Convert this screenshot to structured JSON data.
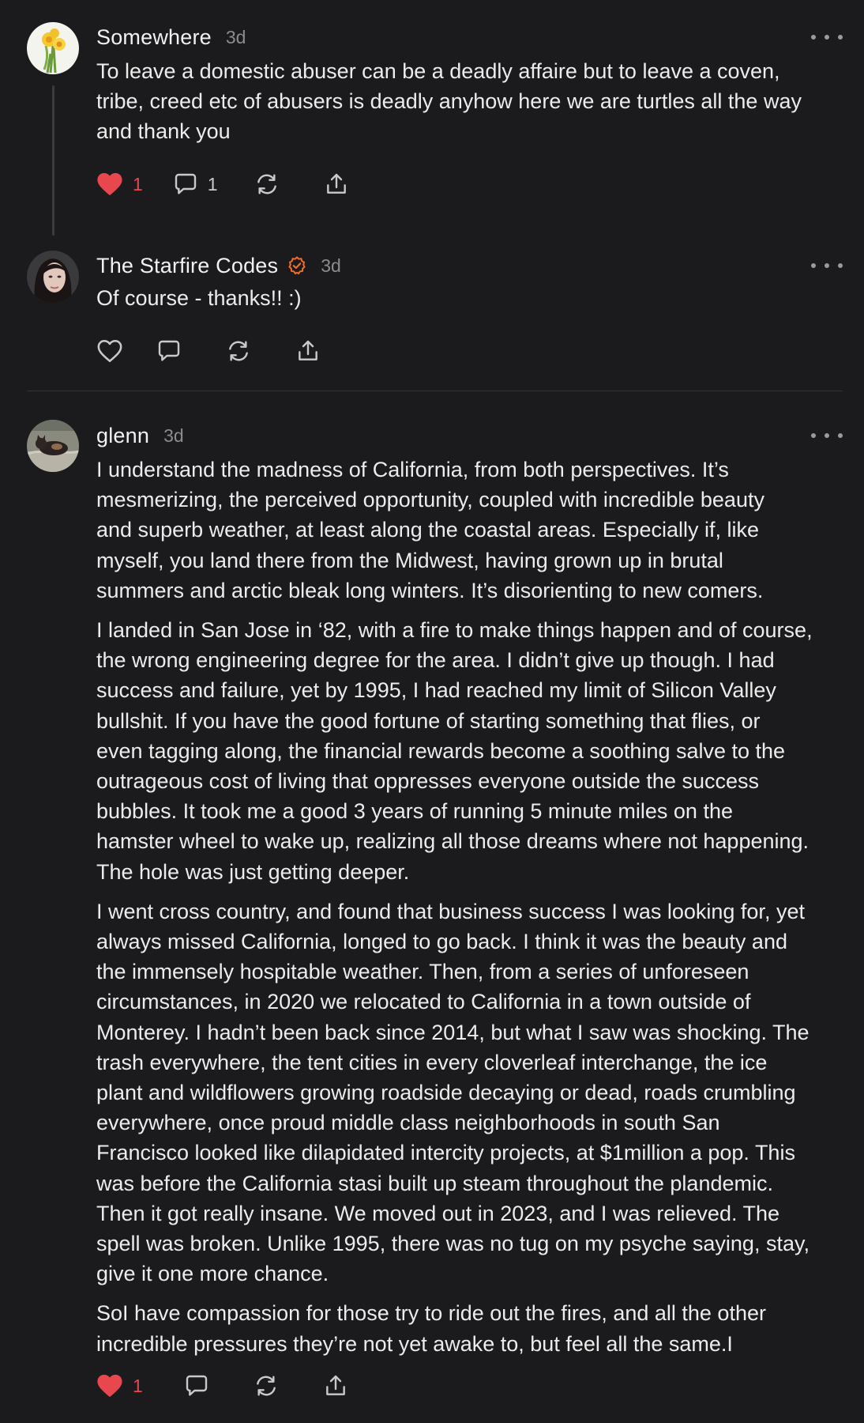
{
  "comments": [
    {
      "author": "Somewhere",
      "time": "3d",
      "avatar_icon": "daffodil-avatar-icon",
      "paragraphs": [
        [
          "To leave a domestic abuser can be a deadly affaire but to leave a coven,",
          "tribe, creed etc of abusers is deadly anyhow here we are turtles all the way",
          "and thank you"
        ]
      ],
      "likes": "1",
      "replies": "1",
      "liked": true
    },
    {
      "author": "The Starfire Codes",
      "time": "3d",
      "verified": true,
      "avatar_icon": "woman-portrait-avatar-icon",
      "paragraphs": [
        [
          "Of course - thanks!! :)"
        ]
      ],
      "liked": false
    },
    {
      "author": "glenn",
      "time": "3d",
      "avatar_icon": "cat-photo-avatar-icon",
      "paragraphs": [
        [
          "I understand the madness of California, from both perspectives. It’s",
          "mesmerizing, the perceived opportunity, coupled with incredible beauty",
          "and superb weather, at least along the coastal areas. Especially if, like",
          "myself, you land there from the Midwest, having grown up in brutal",
          "summers and arctic bleak long winters. It’s disorienting to new comers."
        ],
        [
          "I landed in San Jose in ‘82, with a fire to make things happen and of course,",
          "the wrong engineering degree for the area. I didn’t give up though. I had",
          "success and failure, yet by 1995, I had reached my limit of Silicon Valley",
          "bullshit. If you have the good fortune of starting something that flies, or",
          "even tagging along, the financial rewards become a soothing salve to the",
          "outrageous cost of living that oppresses everyone outside the success",
          "bubbles. It took me a good 3 years of running 5 minute miles on the",
          "hamster wheel to wake up, realizing all those dreams where not happening.",
          "The hole was just getting deeper."
        ],
        [
          "I went cross country, and found that business success I was looking for, yet",
          "always missed California, longed to go back. I think it was the beauty and",
          "the immensely hospitable weather. Then, from a series of unforeseen",
          "circumstances, in 2020 we relocated to California in a town outside of",
          "Monterey. I hadn’t been back since 2014, but what I saw was shocking. The",
          "trash everywhere, the tent cities in every cloverleaf interchange, the ice",
          "plant and wildflowers growing roadside decaying or dead, roads crumbling",
          "everywhere, once proud middle class neighborhoods in south San",
          "Francisco looked like dilapidated intercity projects, at $1million a pop. This",
          "was before the California stasi built up steam throughout the plandemic.",
          "Then it got really insane. We moved out in 2023, and I was relieved. The",
          "spell was broken. Unlike 1995, there was no tug on my psyche saying, stay,",
          "give it one more chance."
        ],
        [
          "SoI have compassion for those try to ride out the fires, and all the other",
          "incredible pressures they’re not yet awake to, but feel all the same.I"
        ]
      ],
      "likes": "1",
      "liked": true
    }
  ],
  "colors": {
    "background": "#1b1b1d",
    "text": "#ececec",
    "muted": "#8b8b90",
    "like_red": "#e8474f",
    "verified_orange": "#f26c2b"
  }
}
